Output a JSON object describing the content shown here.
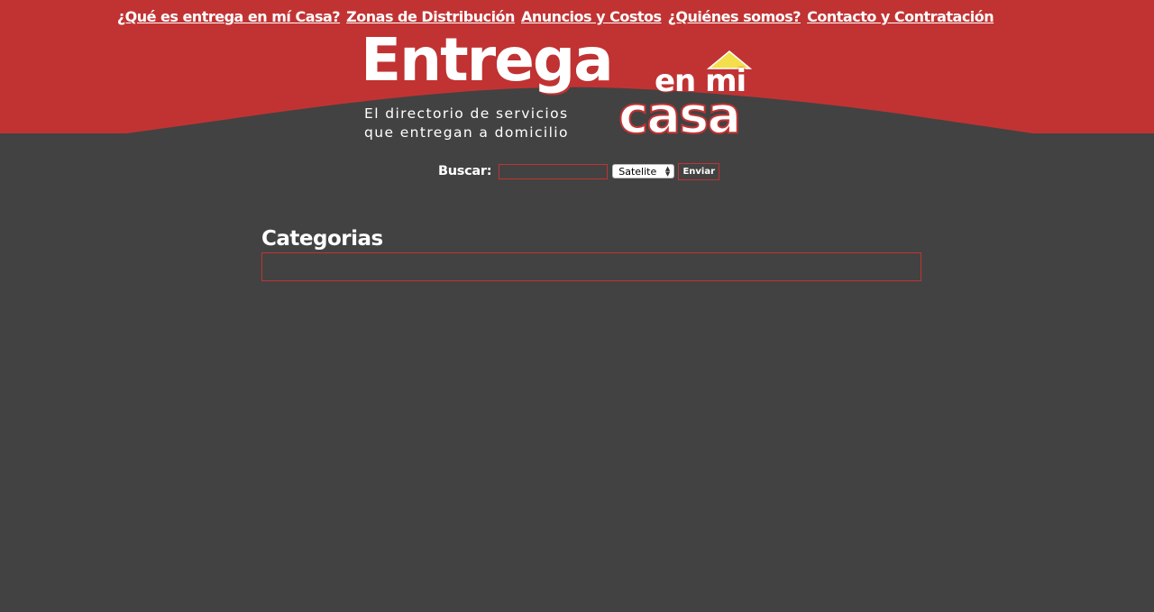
{
  "nav": {
    "items": [
      {
        "label": "¿Qué es entrega en mí Casa?"
      },
      {
        "label": "Zonas de Distribución"
      },
      {
        "label": "Anuncios y Costos"
      },
      {
        "label": "¿Quiénes somos?"
      },
      {
        "label": "Contacto y Contratación"
      }
    ]
  },
  "logo": {
    "word_entrega": "Entrega",
    "word_enmi": "en mi",
    "word_casa": "casa",
    "tagline_line1": "El directorio de servicios",
    "tagline_line2": "que entregan a domicilio"
  },
  "search": {
    "label": "Buscar:",
    "input_value": "",
    "zone_selected": "Satelite",
    "submit_label": "Enviar"
  },
  "main": {
    "categories_title": "Categorias"
  },
  "colors": {
    "brand_red": "#c13333",
    "background_dark": "#424242",
    "roof_yellow": "#f2df4b",
    "text_white": "#ffffff"
  },
  "icons": {
    "logo_roof": "house-roof-icon",
    "select_arrows": "updown-arrows-icon"
  }
}
